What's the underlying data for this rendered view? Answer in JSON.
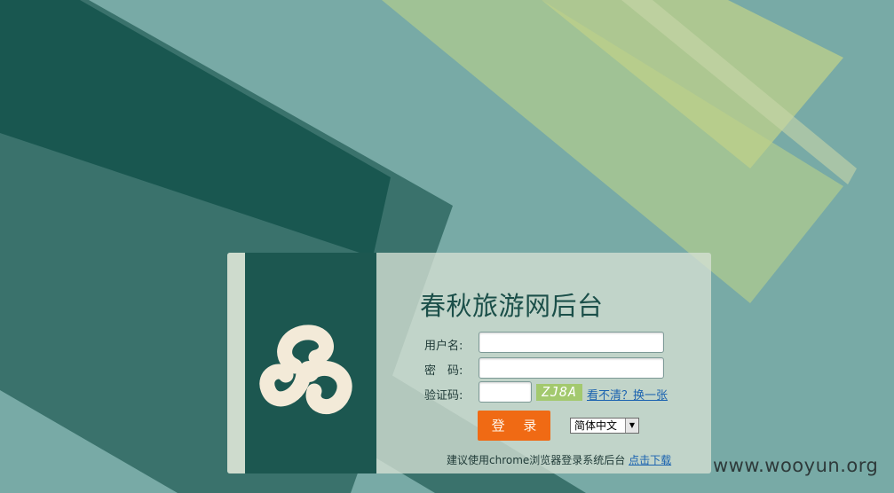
{
  "title": "春秋旅游网后台",
  "form": {
    "username_label": "用户名:",
    "password_label": "密　码:",
    "captcha_label": "验证码:",
    "username_value": "",
    "password_value": "",
    "captcha_value": "",
    "captcha_code": "ZJ8A",
    "refresh_link": "看不清？换一张",
    "login_button": "登 录",
    "language": "简体中文"
  },
  "footer": {
    "hint": "建议使用chrome浏览器登录系统后台",
    "download_link": "点击下载"
  },
  "watermark": "www.wooyun.org",
  "colors": {
    "brand_panel": "#1c5750",
    "login_button": "#f06a14",
    "title": "#1b4f49",
    "logo": "#f3ead8"
  }
}
